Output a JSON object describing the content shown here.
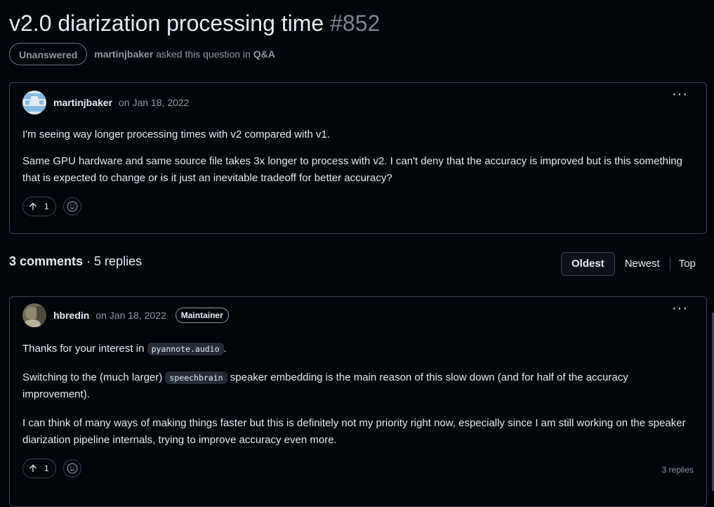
{
  "header": {
    "title": "v2.0 diarization processing time",
    "number": "#852",
    "status": "Unanswered",
    "author": "martinjbaker",
    "asked_text": "asked this question in",
    "category": "Q&A"
  },
  "question": {
    "author": "martinjbaker",
    "date": "on Jan 18, 2022",
    "paragraphs": [
      "I'm seeing way longer processing times with v2 compared with v1.",
      "Same GPU hardware and same source file takes 3x longer to process with v2. I can't deny that the accuracy is improved but is this something that is expected to change or is it just an inevitable tradeoff for better accuracy?"
    ],
    "upvotes": "1",
    "menu": "···"
  },
  "comments_header": {
    "count": "3 comments",
    "sep": " · ",
    "replies": "5 replies",
    "sort_options": [
      "Oldest",
      "Newest",
      "Top"
    ]
  },
  "comment1": {
    "author": "hbredin",
    "date": "on Jan 18, 2022",
    "badge": "Maintainer",
    "p1_before": "Thanks for your interest in ",
    "p1_code": "pyannote.audio",
    "p1_after": ".",
    "p2_before": "Switching to the (much larger) ",
    "p2_code": "speechbrain",
    "p2_after": " speaker embedding is the main reason of this slow down (and for half of the accuracy improvement).",
    "p3": "I can think of many ways of making things faster but this is definitely not my priority right now, especially since I am still working on the speaker diarization pipeline internals, trying to improve accuracy even more.",
    "upvotes": "1",
    "replies": "3 replies",
    "menu": "···"
  },
  "colors": {
    "background": "#010409",
    "border": "#3d444d",
    "text": "#e6edf3",
    "muted": "#9198a1"
  }
}
